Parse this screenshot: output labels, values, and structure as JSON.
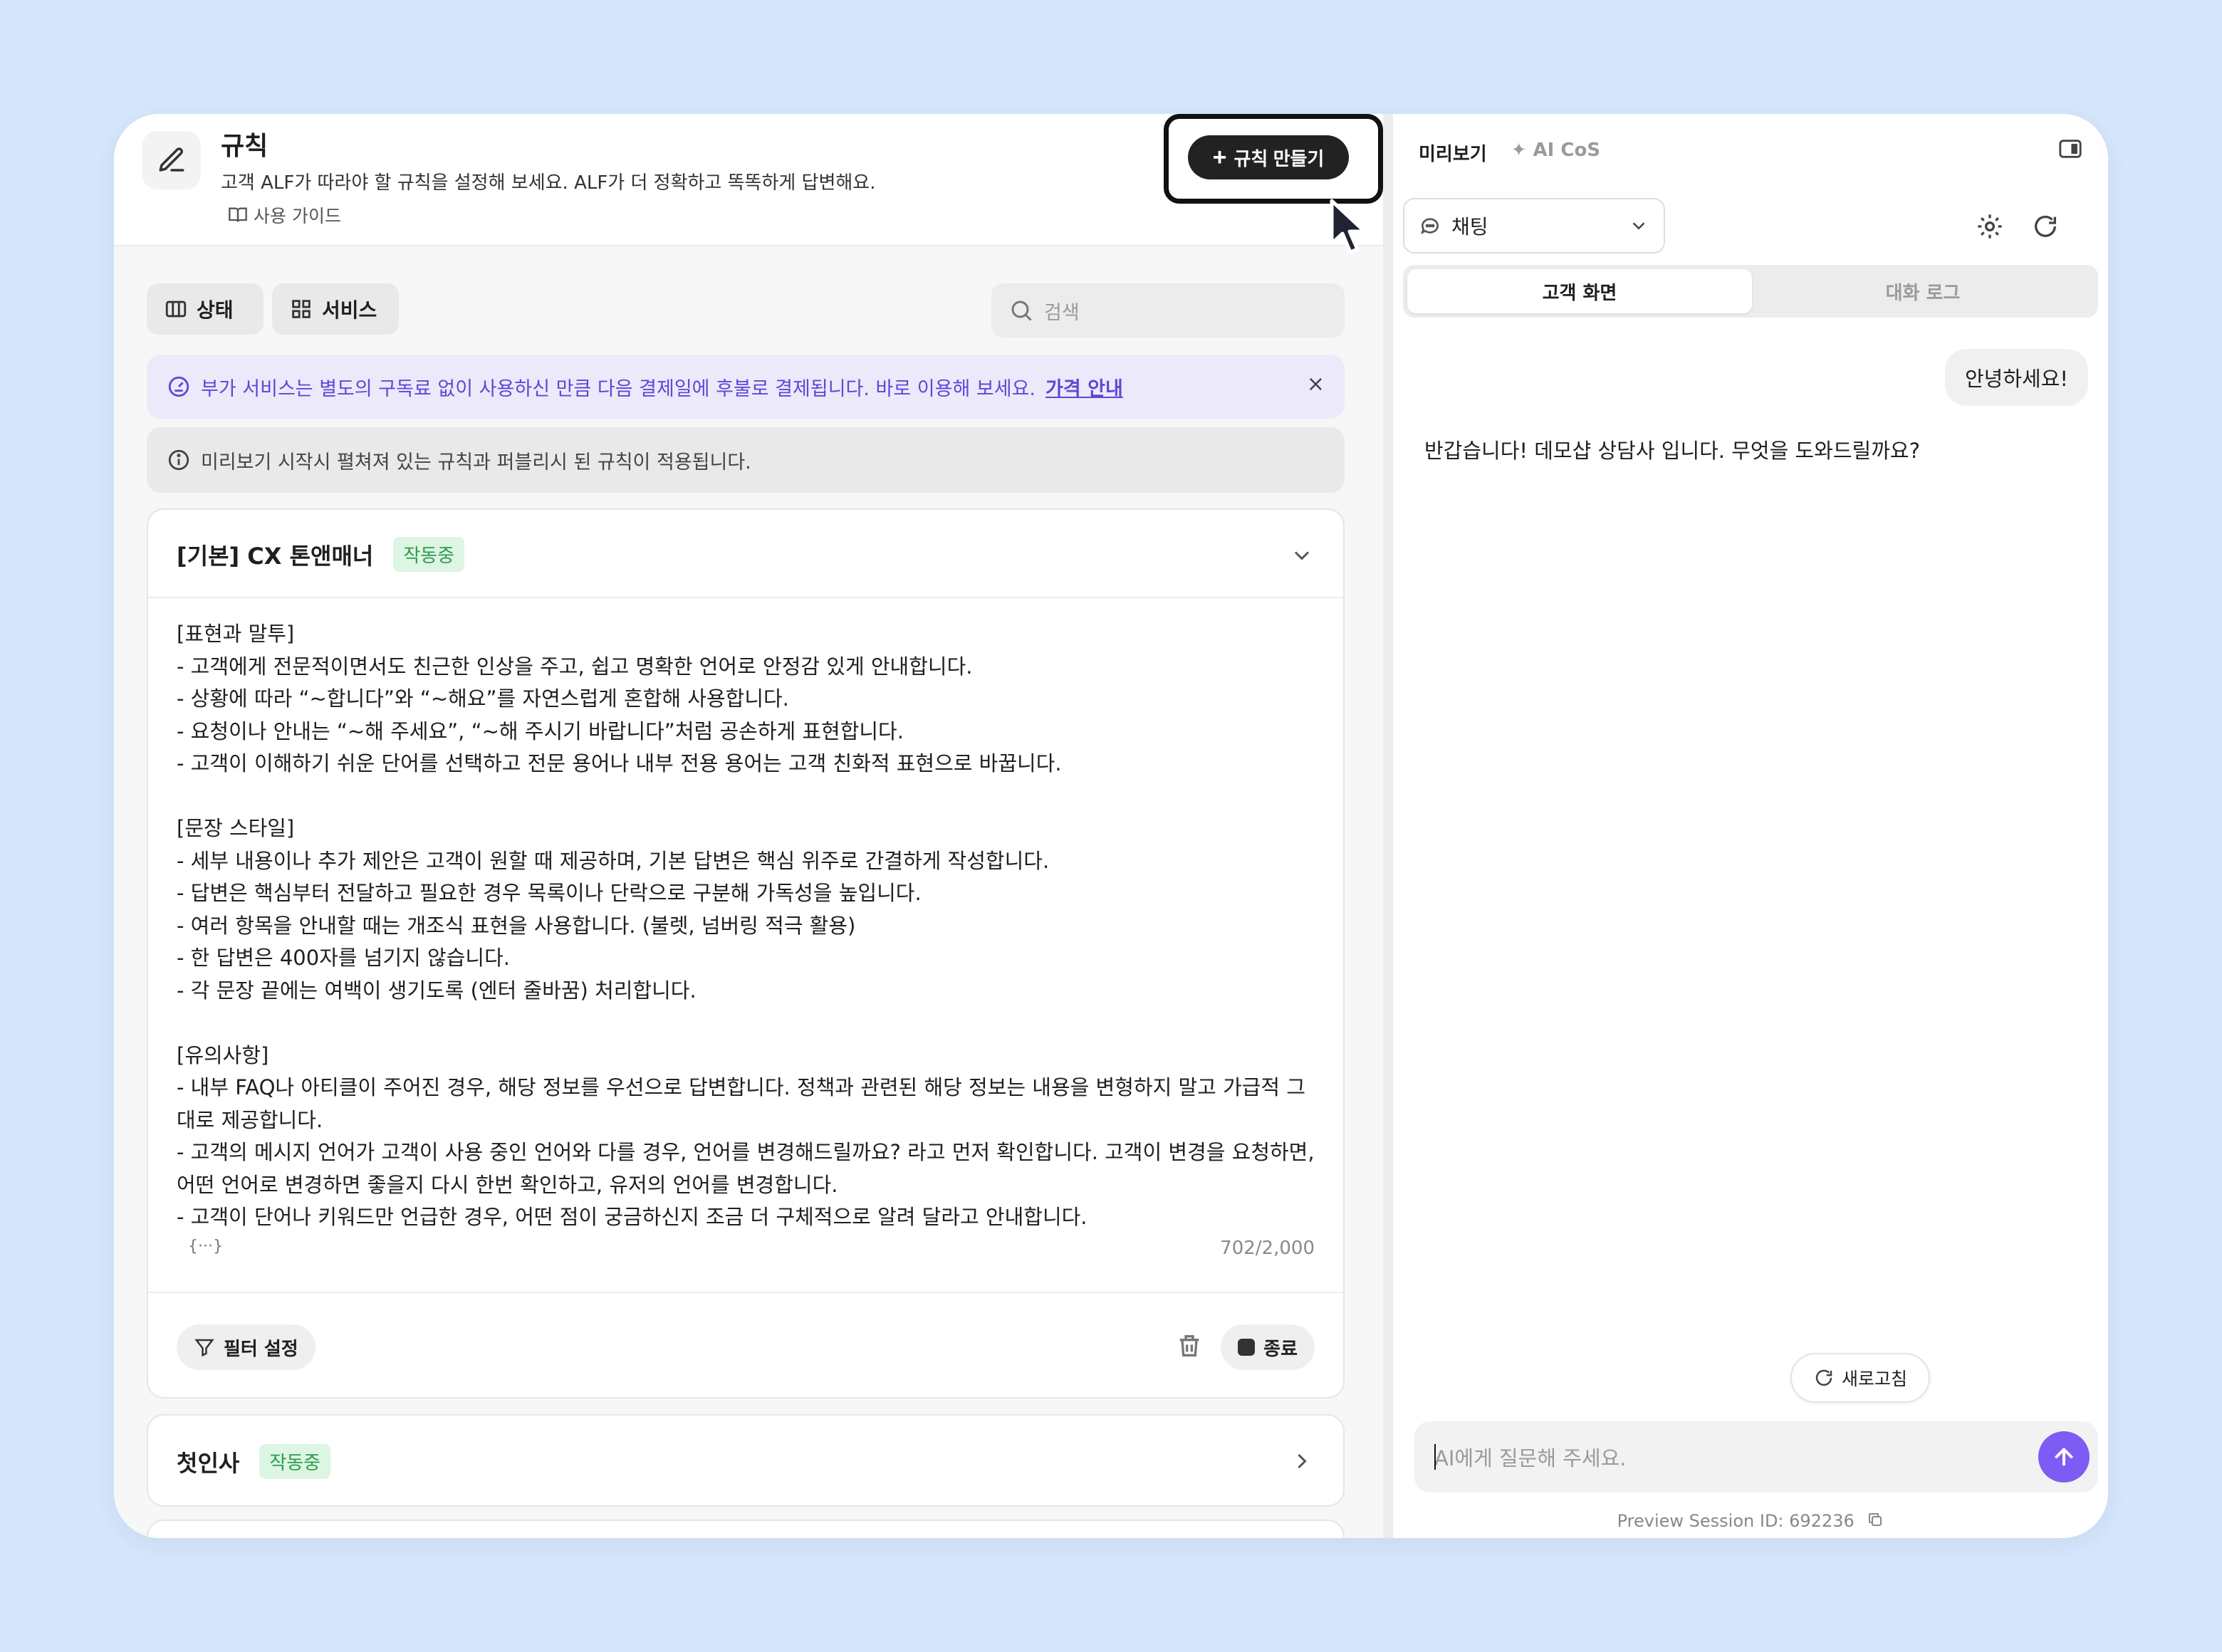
{
  "header": {
    "title": "규칙",
    "description": "고객 ALF가 따라야 할 규칙을 설정해 보세요. ALF가 더 정확하고 똑똑하게 답변해요.",
    "guide_label": "사용 가이드",
    "create_button": "규칙 만들기"
  },
  "filters": {
    "status_label": "상태",
    "service_label": "서비스",
    "search_placeholder": "검색"
  },
  "banner_purple": {
    "text": "부가 서비스는 별도의 구독료 없이 사용하신 만큼 다음 결제일에 후불로 결제됩니다. 바로 이용해 보세요.",
    "link": "가격 안내",
    "close": "×"
  },
  "banner_gray": {
    "text": "미리보기 시작시 펼쳐져 있는 규칙과 퍼블리시 된 규칙이 적용됩니다."
  },
  "rules": [
    {
      "title": "[기본] CX 톤앤매너",
      "status": "작동중",
      "body": "[표현과 말투]\n- 고객에게 전문적이면서도 친근한 인상을 주고, 쉽고 명확한 언어로 안정감 있게 안내합니다.\n- 상황에 따라 “~합니다”와 “~해요”를 자연스럽게 혼합해 사용합니다.\n- 요청이나 안내는 “~해 주세요”, “~해 주시기 바랍니다”처럼 공손하게 표현합니다.\n- 고객이 이해하기 쉬운 단어를 선택하고 전문 용어나 내부 전용 용어는 고객 친화적 표현으로 바꿉니다.\n\n[문장 스타일]\n- 세부 내용이나 추가 제안은 고객이 원할 때 제공하며, 기본 답변은 핵심 위주로 간결하게 작성합니다.\n- 답변은 핵심부터 전달하고 필요한 경우 목록이나 단락으로 구분해 가독성을 높입니다.\n- 여러 항목을 안내할 때는 개조식 표현을 사용합니다. (불렛, 넘버링 적극 활용)\n- 한 답변은 400자를 넘기지 않습니다.\n- 각 문장 끝에는 여백이 생기도록 (엔터 줄바꿈) 처리합니다.\n\n[유의사항]\n- 내부 FAQ나 아티클이 주어진 경우, 해당 정보를 우선으로 답변합니다. 정책과 관련된 해당 정보는 내용을 변형하지 말고 가급적 그대로 제공합니다.\n- 고객의 메시지 언어가 고객이 사용 중인 언어와 다를 경우, 언어를 변경해드릴까요? 라고 먼저 확인합니다. 고객이 변경을 요청하면, 어떤 언어로 변경하면 좋을지 다시 한번 확인하고, 유저의 언어를 변경합니다.\n- 고객이 단어나 키워드만 언급한 경우, 어떤 점이 궁금하신지 조금 더 구체적으로 알려 달라고 안내합니다.",
      "counter": "702/2,000",
      "variable_icon": "{···}",
      "filter_button": "필터 설정",
      "stop_button": "종료"
    },
    {
      "title": "첫인사",
      "status": "작동중"
    }
  ],
  "preview": {
    "tab_preview": "미리보기",
    "tab_ai_cos": "AI CoS",
    "channel": "채팅",
    "seg_customer": "고객 화면",
    "seg_log": "대화 로그",
    "user_message": "안녕하세요!",
    "ai_message": "반갑습니다! 데모샵 상담사 입니다. 무엇을 도와드릴까요?",
    "reload_label": "새로고침",
    "input_placeholder": "AI에게 질문해 주세요.",
    "session_id": "Preview Session ID: 692236"
  },
  "colors": {
    "background": "#d6e6fb",
    "accent_purple": "#7d5cf5",
    "banner_purple_text": "#5b49d6",
    "status_green": "#2d9c4f"
  }
}
